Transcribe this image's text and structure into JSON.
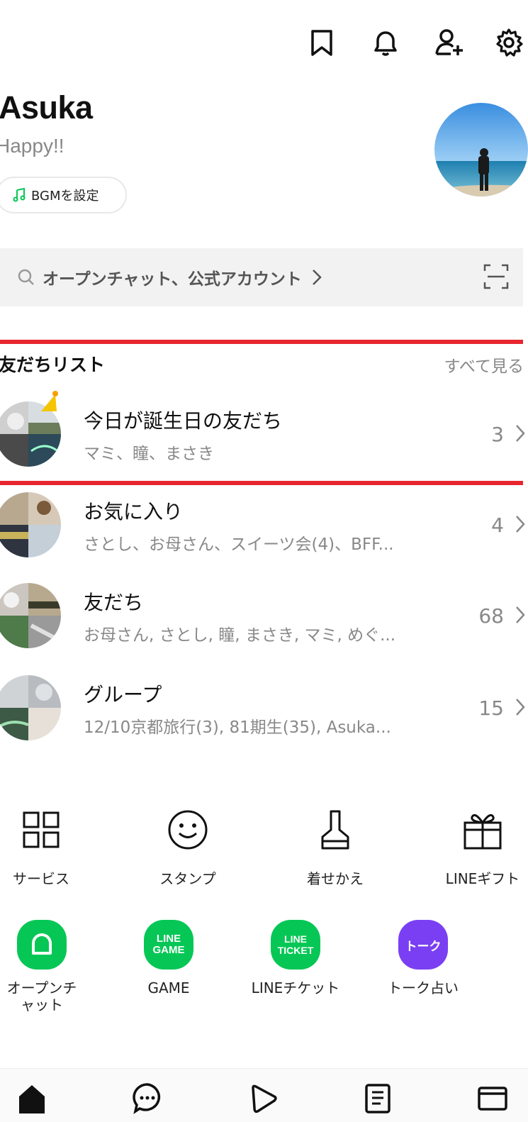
{
  "header": {
    "icons": [
      "bookmark-icon",
      "bell-icon",
      "add-friend-icon",
      "settings-gear-icon"
    ]
  },
  "profile": {
    "name": "Asuka",
    "status": "Happy!!",
    "bgm_label": "BGMを設定"
  },
  "search": {
    "placeholder": "オープンチャット、公式アカウント"
  },
  "friends_section": {
    "title": "友だちリスト",
    "see_all": "すべて見る",
    "rows": [
      {
        "title": "今日が誕生日の友だち",
        "subtitle": "マミ、瞳、まさき",
        "count": "3"
      },
      {
        "title": "お気に入り",
        "subtitle": "さとし、お母さん、スイーツ会(4)、BFF...",
        "count": "4"
      },
      {
        "title": "友だち",
        "subtitle": "お母さん, さとし, 瞳,  まさき, マミ,  めぐ...",
        "count": "68"
      },
      {
        "title": "グループ",
        "subtitle": "12/10京都旅行(3), 81期生(35), Asuka...",
        "count": "15"
      }
    ]
  },
  "services": [
    {
      "label": "サービス",
      "icon": "grid-icon"
    },
    {
      "label": "スタンプ",
      "icon": "smiley-icon"
    },
    {
      "label": "着せかえ",
      "icon": "brush-icon"
    },
    {
      "label": "LINEギフト",
      "icon": "gift-icon"
    }
  ],
  "apps": [
    {
      "label": "オープンチ\nャット",
      "icon": "openchat-icon",
      "color": "#06c755",
      "badge": ""
    },
    {
      "label": "GAME",
      "icon": "line-game-icon",
      "color": "#06c755",
      "badge": "LINE\nGAME"
    },
    {
      "label": "LINEチケット",
      "icon": "line-ticket-icon",
      "color": "#06c755",
      "badge": "LINE\nTICKET"
    },
    {
      "label": "トーク占い",
      "icon": "talk-fortune-icon",
      "color": "#7a3ff2",
      "badge": "トーク"
    }
  ],
  "tabbar": {
    "tabs": [
      "home-icon",
      "chat-icon",
      "voom-icon",
      "news-icon",
      "wallet-icon"
    ]
  },
  "colors": {
    "accent_red": "#e8262f",
    "line_green": "#06c755",
    "fortune_purple": "#7a3ff2"
  }
}
